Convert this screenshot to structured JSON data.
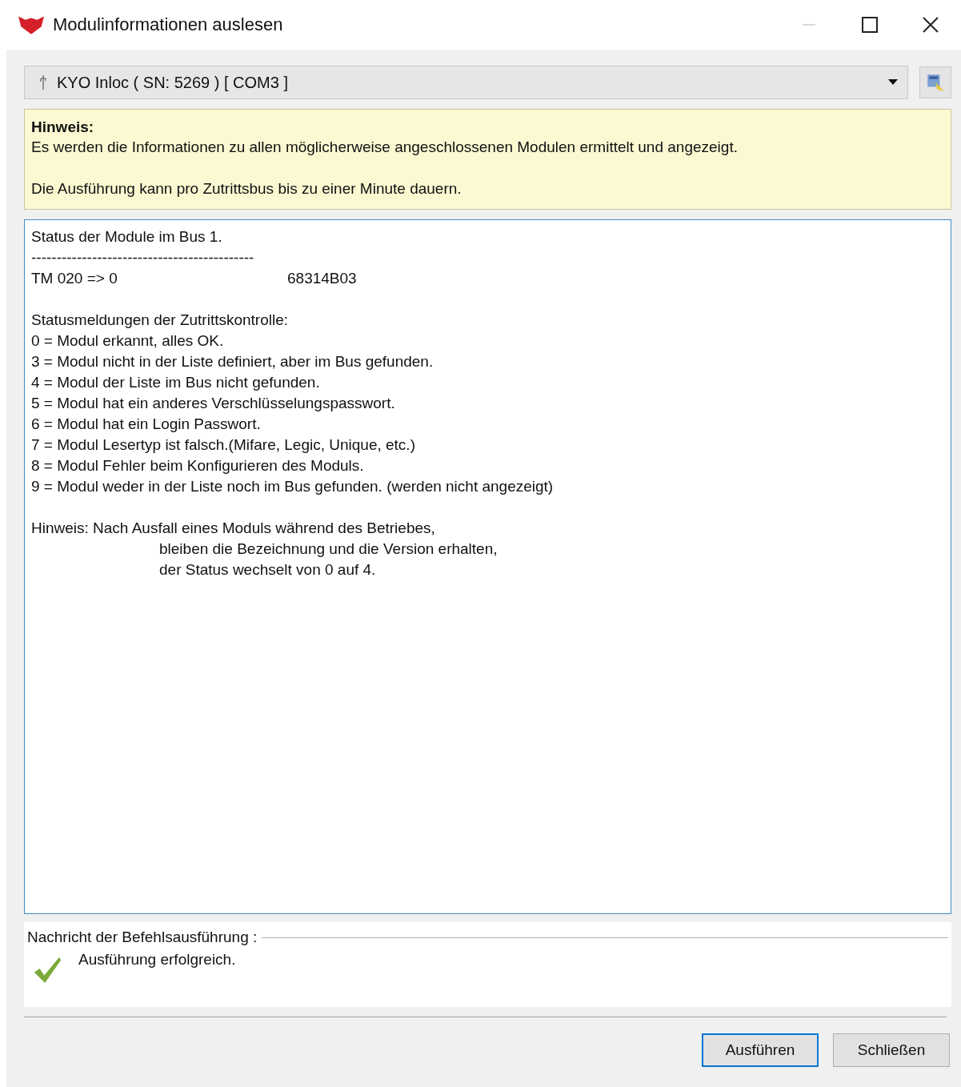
{
  "window": {
    "title": "Modulinformationen auslesen"
  },
  "device_select": {
    "value": "KYO Inloc ( SN: 5269 ) [ COM3 ]"
  },
  "notice": {
    "title": "Hinweis:",
    "paragraphs": [
      "Es werden die Informationen zu allen möglicherweise angeschlossenen Modulen ermittelt und angezeigt.",
      "Die Ausführung kann pro Zutrittsbus bis zu einer Minute dauern."
    ]
  },
  "output": {
    "blocks": [
      {
        "lines": [
          {
            "kind": "text",
            "text": "Status der Module im Bus 1."
          },
          {
            "kind": "text",
            "text": "--------------------------------------------"
          },
          {
            "kind": "entry",
            "text": "TM 020 => 0",
            "value": "68314B03"
          }
        ]
      },
      {
        "lines": [
          {
            "kind": "text",
            "text": "Statusmeldungen der Zutrittskontrolle:"
          },
          {
            "kind": "text",
            "text": "0 = Modul erkannt, alles OK."
          },
          {
            "kind": "text",
            "text": "3 = Modul nicht in der Liste definiert, aber im Bus gefunden."
          },
          {
            "kind": "text",
            "text": "4 = Modul der Liste im Bus nicht gefunden."
          },
          {
            "kind": "text",
            "text": "5 = Modul hat ein anderes Verschlüsselungspasswort."
          },
          {
            "kind": "text",
            "text": "6 = Modul hat ein Login Passwort."
          },
          {
            "kind": "text",
            "text": "7 = Modul Lesertyp ist falsch.(Mifare, Legic, Unique, etc.)"
          },
          {
            "kind": "text",
            "text": "8 = Modul Fehler beim Konfigurieren des Moduls."
          },
          {
            "kind": "text",
            "text": "9 = Modul weder in der Liste noch im Bus gefunden. (werden nicht angezeigt)"
          }
        ]
      },
      {
        "lines": [
          {
            "kind": "text",
            "text": "Hinweis: Nach Ausfall eines Moduls während des Betriebes,"
          },
          {
            "kind": "indent",
            "text": "bleiben die Bezeichnung und die Version erhalten,"
          },
          {
            "kind": "indent",
            "text": "der Status wechselt von 0 auf 4."
          }
        ]
      }
    ]
  },
  "message": {
    "label": "Nachricht der Befehlsausführung :",
    "text": "Ausführung erfolgreich."
  },
  "buttons": [
    {
      "label": "Ausführen",
      "selected": true
    },
    {
      "label": "Schließen",
      "selected": false
    }
  ]
}
